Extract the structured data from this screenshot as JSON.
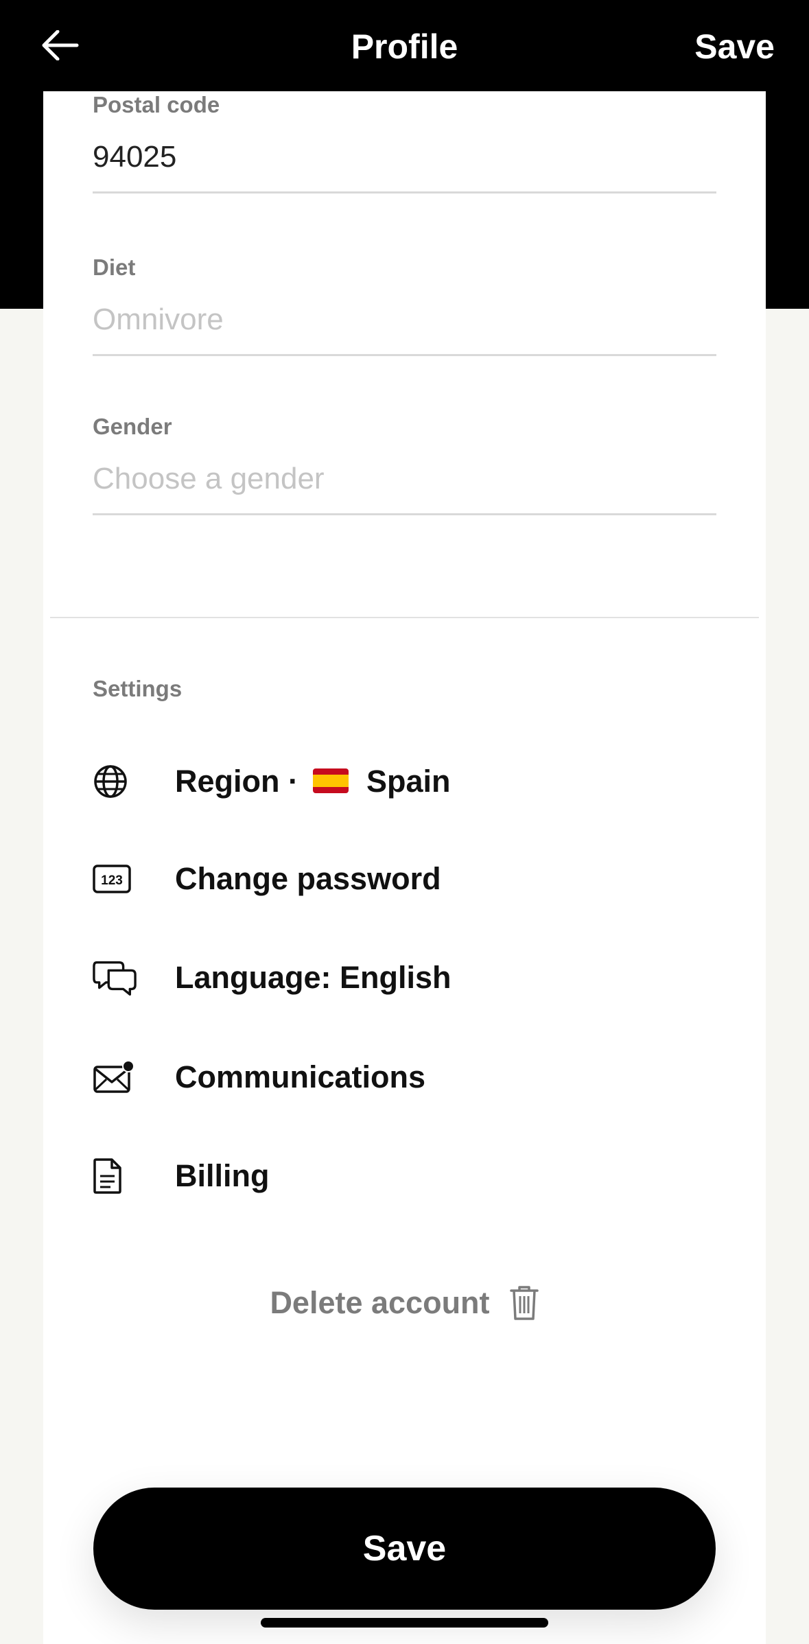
{
  "header": {
    "title": "Profile",
    "save_label": "Save"
  },
  "form": {
    "postal_code": {
      "label": "Postal code",
      "value": "94025"
    },
    "diet": {
      "label": "Diet",
      "placeholder": "Omnivore"
    },
    "gender": {
      "label": "Gender",
      "placeholder": "Choose a gender"
    }
  },
  "settings": {
    "heading": "Settings",
    "region": {
      "prefix": "Region ·",
      "country": "Spain",
      "icon": "globe-icon"
    },
    "change_password": {
      "label": "Change password",
      "icon": "password-123-icon"
    },
    "language": {
      "label": "Language: English",
      "icon": "chat-bubbles-icon"
    },
    "communications": {
      "label": "Communications",
      "icon": "mail-notification-icon"
    },
    "billing": {
      "label": "Billing",
      "icon": "document-icon"
    }
  },
  "delete_account": {
    "label": "Delete account",
    "icon": "trash-icon"
  },
  "footer": {
    "save_label": "Save"
  },
  "colors": {
    "header_bg": "#000000",
    "page_bg": "#f6f6f2",
    "card_bg": "#ffffff",
    "muted_text": "#7b7b7b",
    "placeholder_text": "#c4c4c4",
    "primary_button": "#000000"
  }
}
